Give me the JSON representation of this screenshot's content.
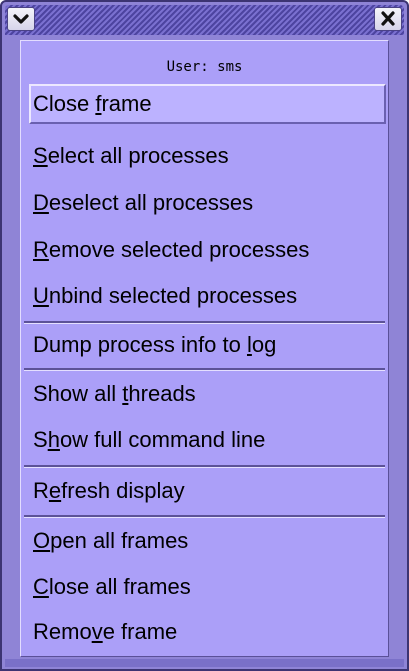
{
  "window": {
    "menu_button_icon": "chevron-down-icon",
    "close_button_icon": "close-icon"
  },
  "menu": {
    "header": "User: sms",
    "items": [
      {
        "pre": "Close ",
        "mn": "f",
        "post": "rame"
      },
      {
        "pre": "",
        "mn": "S",
        "post": "elect all processes"
      },
      {
        "pre": "",
        "mn": "D",
        "post": "eselect all processes"
      },
      {
        "pre": "",
        "mn": "R",
        "post": "emove selected processes"
      },
      {
        "pre": "",
        "mn": "U",
        "post": "nbind selected processes"
      },
      {
        "pre": "Dump process info to ",
        "mn": "l",
        "post": "og"
      },
      {
        "pre": "Show all ",
        "mn": "t",
        "post": "hreads"
      },
      {
        "pre": "S",
        "mn": "h",
        "post": "ow full command line"
      },
      {
        "pre": "R",
        "mn": "e",
        "post": "fresh display"
      },
      {
        "pre": "",
        "mn": "O",
        "post": "pen all frames"
      },
      {
        "pre": "",
        "mn": "C",
        "post": "lose all frames"
      },
      {
        "pre": "Remo",
        "mn": "v",
        "post": "e frame"
      }
    ]
  },
  "colors": {
    "menu_background": "#ab9ff8",
    "frame": "#8f84d6",
    "highlight": "#bcb2ff"
  }
}
